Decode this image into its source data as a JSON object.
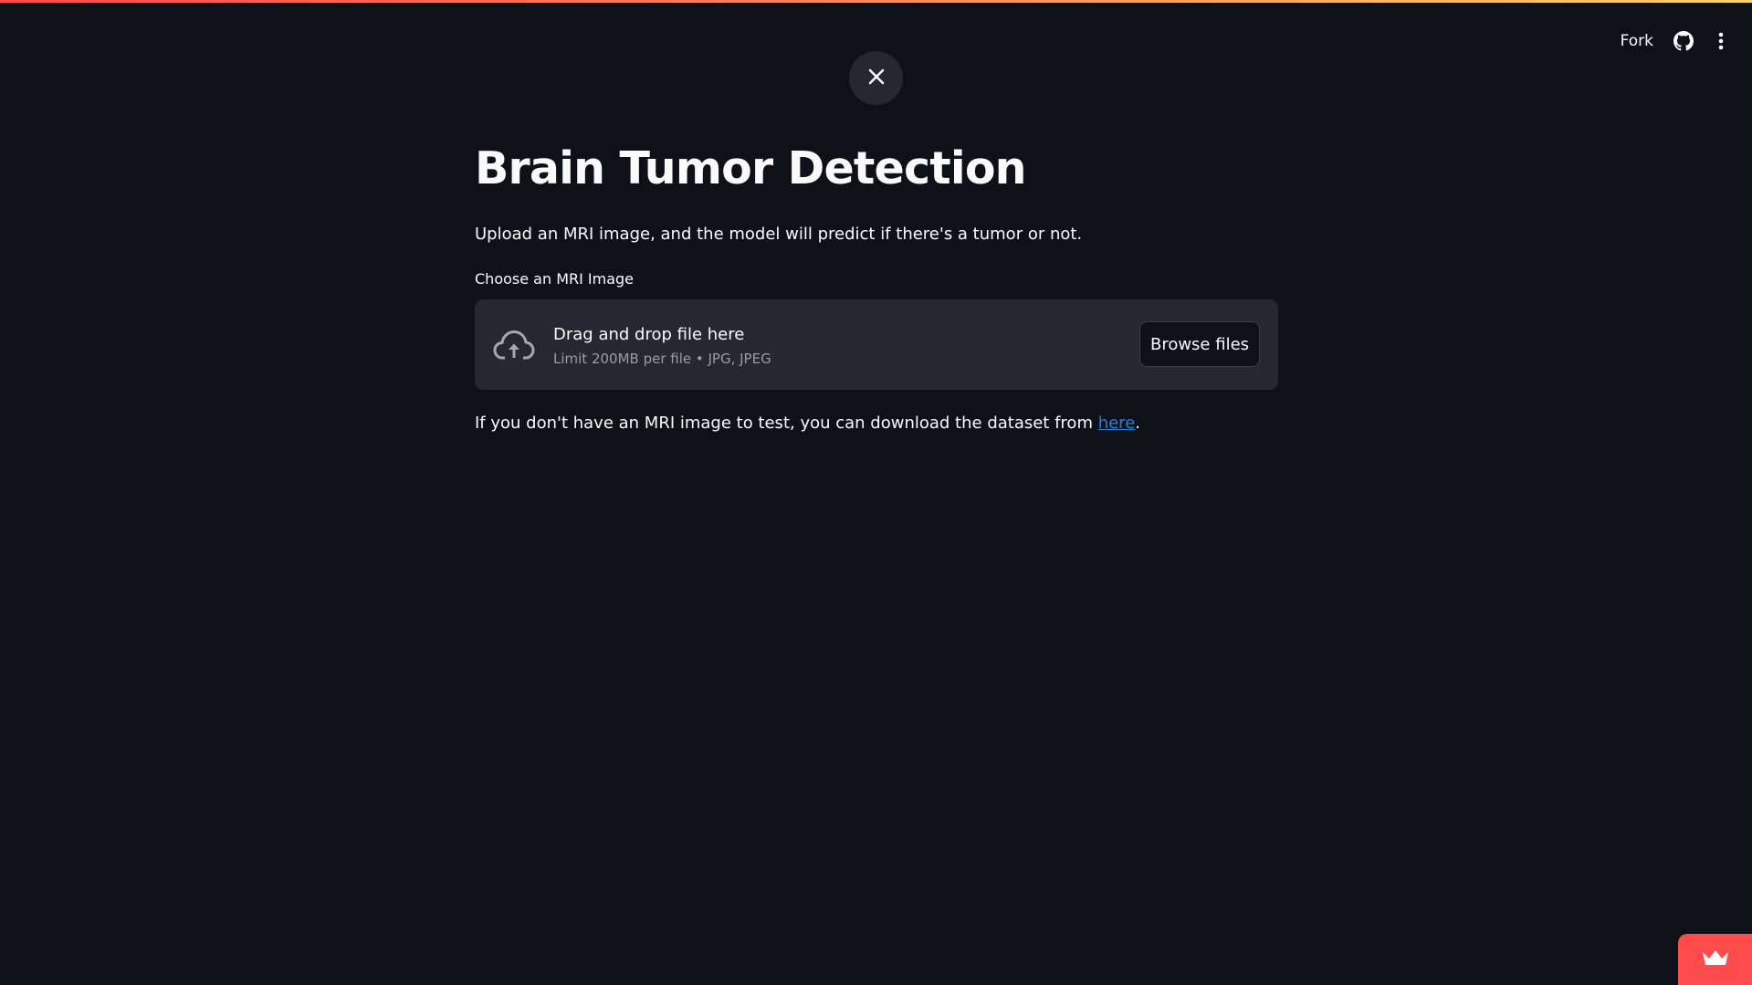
{
  "header": {
    "fork_label": "Fork",
    "github_icon": "github-icon",
    "menu_icon": "vertical-ellipsis-icon"
  },
  "close_button": {
    "icon": "close-icon"
  },
  "main": {
    "title": "Brain Tumor Detection",
    "subtitle": "Upload an MRI image, and the model will predict if there's a tumor or not.",
    "uploader": {
      "label": "Choose an MRI Image",
      "icon": "cloud-upload-icon",
      "dropzone_text": "Drag and drop file here",
      "limit_text": "Limit 200MB per file • JPG, JPEG",
      "browse_label": "Browse files"
    },
    "note": {
      "prefix": "If you don't have an MRI image to test, you can download the dataset from ",
      "link_text": "here",
      "suffix": "."
    }
  },
  "badge": {
    "icon": "crown-icon"
  },
  "colors": {
    "background": "#0e1117",
    "surface": "#262730",
    "accent": "#ff4b4b",
    "link": "#1c83e1",
    "text": "#fafafa",
    "muted": "#9a9ca5"
  }
}
